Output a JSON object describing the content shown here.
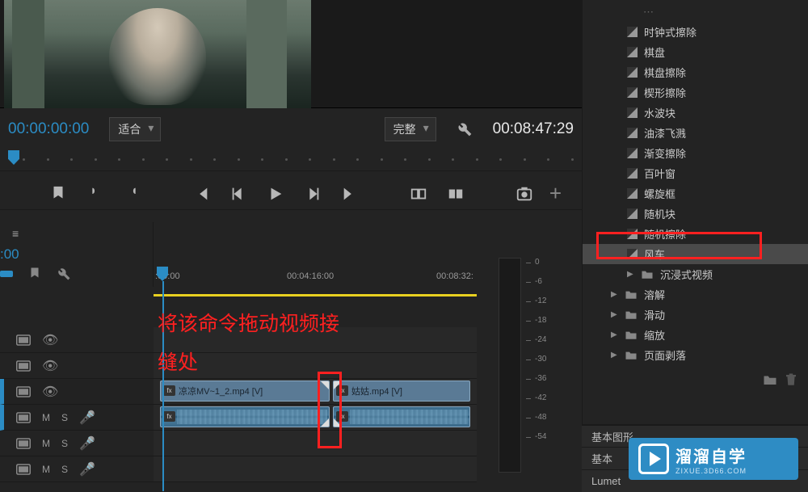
{
  "preview": {
    "timecode_left": "00:00:00:00",
    "fit_label": "适合",
    "quality_label": "完整",
    "timecode_right": "00:08:47:29"
  },
  "timeline": {
    "menu_label": "≡",
    "current_time": ":00",
    "ruler_marks": [
      ":00:00",
      "00:04:16:00",
      "00:08:32:"
    ],
    "tracks": {
      "v1_clip1_label": "凉凉MV~1_2.mp4 [V]",
      "v1_clip2_label": "姑姑.mp4 [V]"
    },
    "track_letters": {
      "m": "M",
      "s": "S"
    },
    "annotation": "将该命令拖动视频接\n缝处"
  },
  "audio_meter": {
    "labels": [
      "0",
      "-6",
      "-12",
      "-18",
      "-24",
      "-30",
      "-36",
      "-42",
      "-48",
      "-54"
    ]
  },
  "effects": {
    "items": [
      "时钟式擦除",
      "棋盘",
      "棋盘擦除",
      "楔形擦除",
      "水波块",
      "油漆飞溅",
      "渐变擦除",
      "百叶窗",
      "螺旋框",
      "随机块",
      "随机擦除"
    ],
    "selected": "风车",
    "folders": {
      "immersive": "沉浸式视频",
      "dissolve": "溶解",
      "slide": "滑动",
      "zoom": "缩放",
      "peel": "页面剥落"
    }
  },
  "bottom_tabs": [
    "基本图形",
    "基本",
    "Lumet"
  ],
  "watermark": {
    "title": "溜溜自学",
    "sub": "ZIXUE.3D66.COM"
  }
}
